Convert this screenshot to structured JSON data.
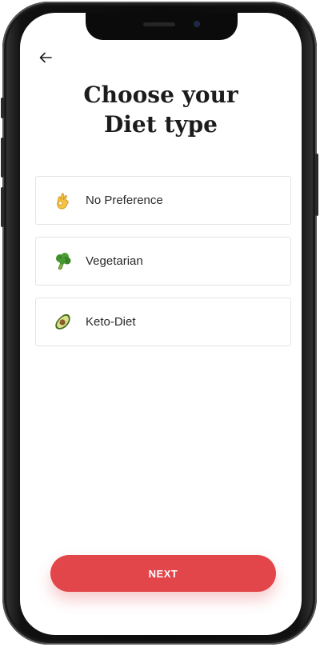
{
  "screen": {
    "title_line1": "Choose your",
    "title_line2": "Diet type"
  },
  "icons": {
    "back": "arrow-left-icon",
    "no_preference": "ok-hand-icon",
    "vegetarian": "broccoli-icon",
    "keto": "avocado-icon"
  },
  "options": [
    {
      "label": "No Preference"
    },
    {
      "label": "Vegetarian"
    },
    {
      "label": "Keto-Diet"
    }
  ],
  "actions": {
    "next_label": "NEXT"
  },
  "colors": {
    "accent": "#e2454a",
    "title": "#1c1c1c",
    "border": "#e4e4e4"
  }
}
